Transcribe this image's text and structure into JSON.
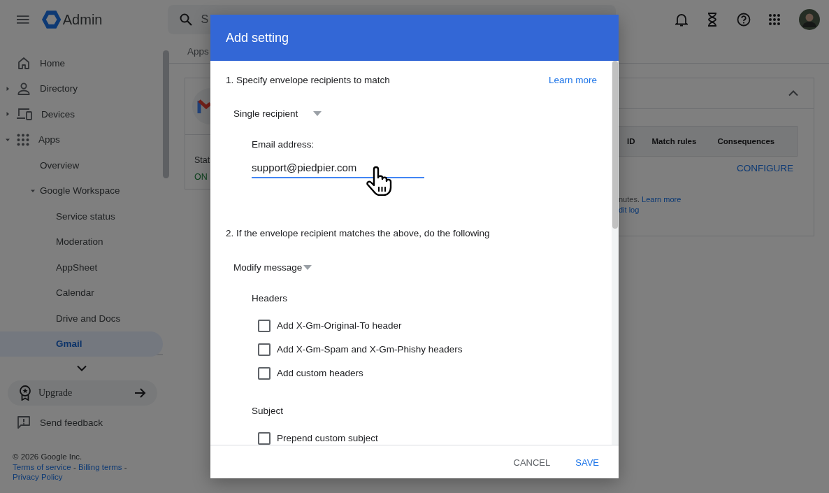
{
  "top_bar": {
    "product": "Admin",
    "search": {
      "placeholder": "S"
    }
  },
  "sidebar": {
    "items": [
      {
        "label": "Home",
        "selected": false
      },
      {
        "label": "Directory",
        "selected": false,
        "expanded": false
      },
      {
        "label": "Devices",
        "selected": false,
        "expanded": false
      },
      {
        "label": "Apps",
        "selected": false,
        "expanded": true,
        "children": [
          {
            "label": "Overview",
            "selected": false
          },
          {
            "label": "Google Workspace",
            "selected": false,
            "expanded": true,
            "children": [
              {
                "label": "Service status",
                "selected": false
              },
              {
                "label": "Moderation",
                "selected": false
              },
              {
                "label": "AppSheet",
                "selected": false
              },
              {
                "label": "Calendar",
                "selected": false
              },
              {
                "label": "Drive and Docs",
                "selected": false
              },
              {
                "label": "Gmail",
                "selected": true
              }
            ]
          }
        ]
      }
    ],
    "upgrade": "Upgrade",
    "feedback": "Send feedback",
    "footer": {
      "copyright": "© 2026 Google Inc.",
      "links": [
        "Terms of service",
        "Billing terms",
        "Privacy Policy"
      ],
      "separator": "-"
    }
  },
  "main": {
    "breadcrumb": "Apps",
    "status_card": {
      "label": "Stat",
      "value": "ON"
    },
    "rules_card": {
      "columns": [
        "ID",
        "Match rules",
        "Consequences"
      ],
      "action": "CONFIGURE",
      "note": "nutes.",
      "note_link": "Learn more",
      "audit_link": "dit log"
    }
  },
  "dialog": {
    "title": "Add setting",
    "section_1": {
      "heading": "1. Specify envelope recipients to match",
      "link": "Learn more",
      "dropdown": "Single recipient",
      "field_label": "Email address:",
      "field_value": "support@piedpier.com"
    },
    "section_2": {
      "heading": "2. If the envelope recipient matches the above, do the following",
      "dropdown": "Modify message",
      "groups": [
        {
          "title": "Headers",
          "options": [
            {
              "label": "Add X-Gm-Original-To header",
              "checked": false
            },
            {
              "label": "Add X-Gm-Spam and X-Gm-Phishy headers",
              "checked": false
            },
            {
              "label": "Add custom headers",
              "checked": false
            }
          ]
        },
        {
          "title": "Subject",
          "options": [
            {
              "label": "Prepend custom subject",
              "checked": false
            }
          ]
        }
      ]
    },
    "buttons": [
      {
        "label": "CANCEL",
        "kind": "secondary"
      },
      {
        "label": "SAVE",
        "kind": "primary"
      }
    ]
  }
}
